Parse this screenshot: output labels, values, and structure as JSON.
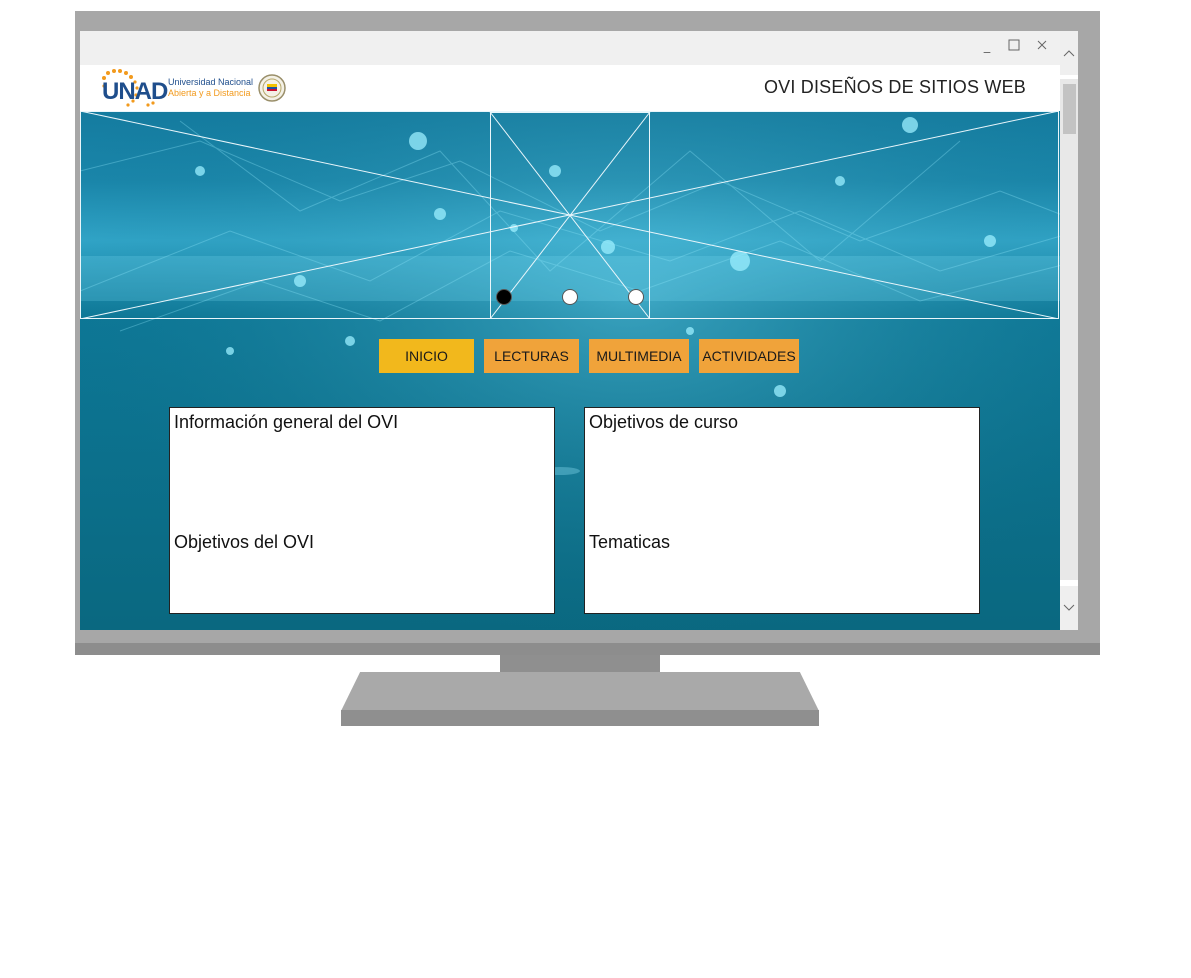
{
  "window": {
    "minimize_icon": "minimize-icon",
    "maximize_icon": "maximize-icon",
    "close_icon": "close-icon"
  },
  "header": {
    "logo": {
      "brand": "UNAD",
      "line1": "Universidad Nacional",
      "line2": "Abierta y a Distancia"
    },
    "title": "OVI DISEÑOS DE SITIOS WEB"
  },
  "slider": {
    "dots": [
      "active",
      "inactive",
      "inactive"
    ]
  },
  "nav": {
    "items": [
      {
        "label": "INICIO",
        "color": "#f2b81c"
      },
      {
        "label": "LECTURAS",
        "color": "#f0a33a"
      },
      {
        "label": "MULTIMEDIA",
        "color": "#f0a33a"
      },
      {
        "label": "ACTIVIDADES",
        "color": "#f0a33a"
      }
    ]
  },
  "panels": {
    "left": {
      "heading1": "Información general del OVI",
      "heading2": "Objetivos del OVI"
    },
    "right": {
      "heading1": "Objetivos de curso",
      "heading2": "Tematicas"
    }
  },
  "colors": {
    "screen_bg": "#0f6f8c",
    "monitor": "#a7a7a7"
  }
}
